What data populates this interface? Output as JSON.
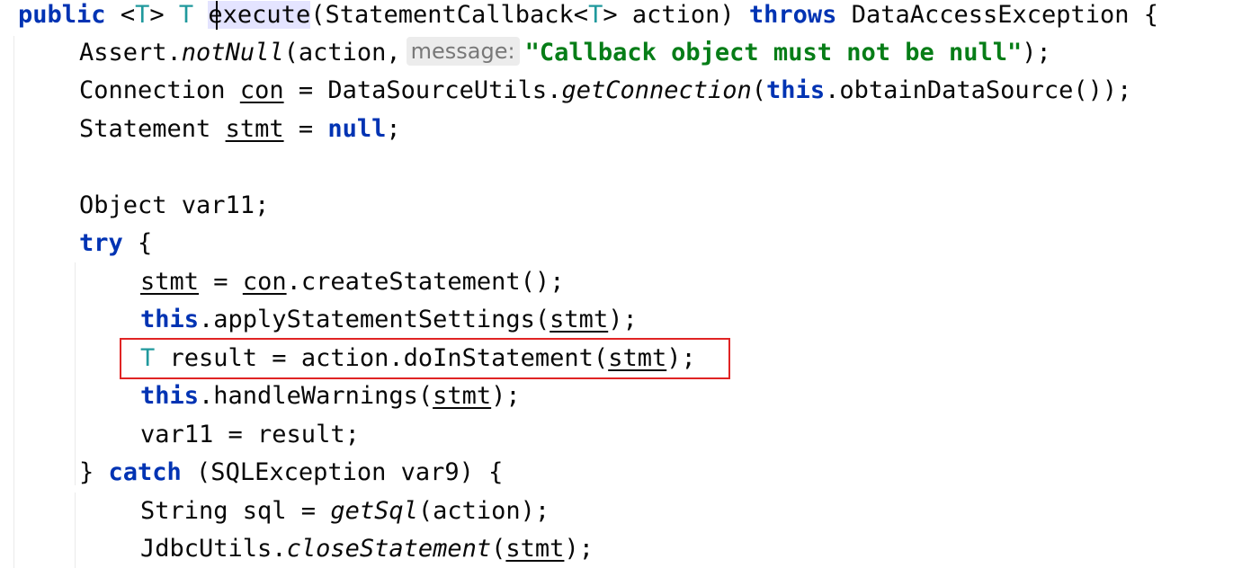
{
  "colors": {
    "keyword": "#0033b3",
    "type_param": "#20999d",
    "string": "#067d17",
    "plain": "#080808",
    "hint_bg": "#ececec",
    "hint_text": "#787878",
    "identifier_highlight": "#e4e4ff",
    "annotation_box": "#e02424"
  },
  "lines": [
    {
      "modifier": "public",
      "lt": "<",
      "type_param": "T",
      "gt": ">",
      "return_type": "T",
      "method_name": "execute",
      "params_open": "(StatementCallback<",
      "param_type": "T",
      "params_rest": "> action) ",
      "throws_kw": "throws",
      "exception": " DataAccessException {"
    },
    {
      "receiver": "Assert.",
      "method": "notNull",
      "args_open": "(action,",
      "hint_label": "message:",
      "string_literal": "\"Callback object must not be null\"",
      "close": ");"
    },
    {
      "type": "Connection ",
      "var": "con",
      "assign": " = DataSourceUtils.",
      "method": "getConnection",
      "open": "(",
      "this_kw": "this",
      "rest": ".obtainDataSource());"
    },
    {
      "type": "Statement ",
      "var": "stmt",
      "assign": " = ",
      "null_kw": "null",
      "end": ";"
    },
    {
      "text": "Object var11;"
    },
    {
      "try_kw": "try",
      "brace": " {"
    },
    {
      "var": "stmt",
      "assign": " = ",
      "receiver": "con",
      "rest": ".createStatement();"
    },
    {
      "this_kw": "this",
      "call": ".applyStatementSettings(",
      "arg": "stmt",
      "close": ");"
    },
    {
      "type_param": "T",
      "assign": " result = action.doInStatement(",
      "arg": "stmt",
      "close": ");"
    },
    {
      "this_kw": "this",
      "call": ".handleWarnings(",
      "arg": "stmt",
      "close": ");"
    },
    {
      "text": "var11 = result;"
    },
    {
      "brace": "} ",
      "catch_kw": "catch",
      "rest": " (SQLException var9) {"
    },
    {
      "start": "String sql = ",
      "method": "getSql",
      "rest": "(action);"
    },
    {
      "receiver": "JdbcUtils.",
      "method": "closeStatement",
      "open": "(",
      "arg": "stmt",
      "close": ");"
    }
  ]
}
